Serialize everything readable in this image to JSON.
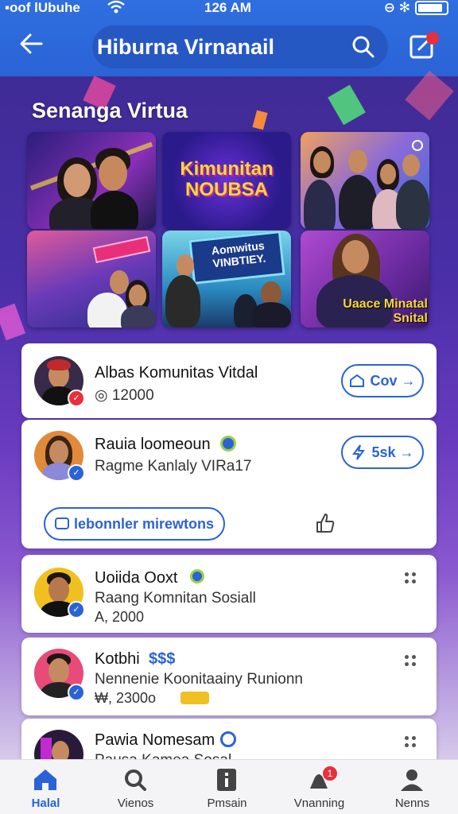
{
  "status_bar": {
    "carrier": "▪oof lUbuhe",
    "time": "126 AM",
    "right_icons": "⊖ ✻"
  },
  "header": {
    "title": "Hiburna Virnanail"
  },
  "hero": {
    "title": "Senanga Virtua",
    "tiles": [
      {
        "caption": ""
      },
      {
        "caption": "Kimunitan NOUBSA"
      },
      {
        "caption": ""
      },
      {
        "caption": ""
      },
      {
        "caption": "Aomwitus VINBTIEY."
      },
      {
        "caption": "Uaace Minatal Snital"
      }
    ]
  },
  "cards": [
    {
      "name": "Albas Komunitas Vitdal",
      "sub": "◎ 12000",
      "action": "Cov →"
    },
    {
      "name": "Rauia loomeoun",
      "sub": "Ragme Kanlaly VIRa17",
      "action": "5sk →",
      "extra_action": "lebonnler mirewtons"
    },
    {
      "name": "Uoiida Ooxt",
      "sub": "Raang Komnitan Sosiall",
      "meta": "A, 2000"
    },
    {
      "name": "Kotbhi",
      "name_tag": "$$$",
      "sub": "Nennenie Koonitaainy Runionn",
      "meta": "₩, 2300o"
    },
    {
      "name": "Pawia Nomesam",
      "sub": "Pausa Kamea Sosal"
    }
  ],
  "bottom_nav": [
    {
      "label": "Halal",
      "icon": "home-icon",
      "active": true
    },
    {
      "label": "Vienos",
      "icon": "search-icon"
    },
    {
      "label": "Pmsain",
      "icon": "info-icon"
    },
    {
      "label": "Vnanning",
      "icon": "notification-icon",
      "badge": "1"
    },
    {
      "label": "Nenns",
      "icon": "profile-icon"
    }
  ],
  "colors": {
    "primary": "#2a63d6",
    "background_top": "#3b2a8f",
    "badge_red": "#e8303a"
  }
}
